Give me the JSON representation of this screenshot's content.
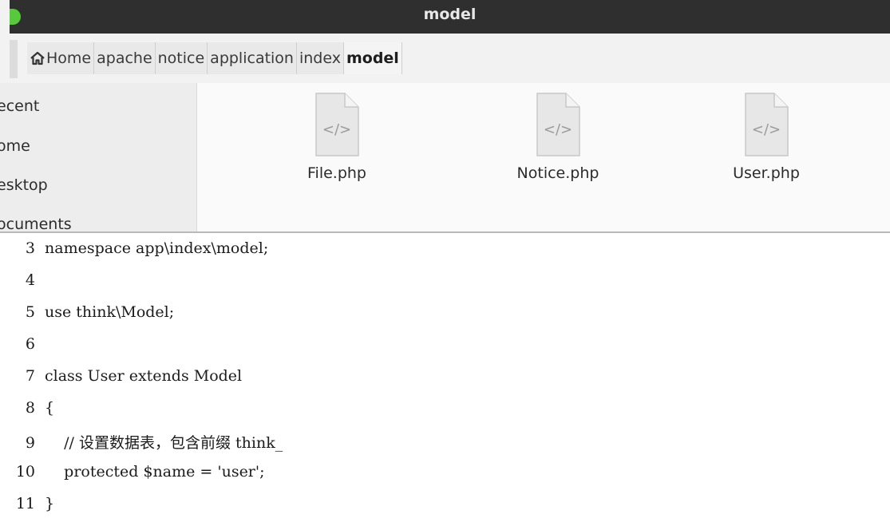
{
  "window": {
    "title": "model"
  },
  "breadcrumbs": [
    {
      "label": "Home",
      "icon": "home-icon"
    },
    {
      "label": "apache"
    },
    {
      "label": "notice"
    },
    {
      "label": "application"
    },
    {
      "label": "index"
    },
    {
      "label": "model",
      "active": true
    }
  ],
  "sidebar": {
    "items": [
      {
        "label": "ecent"
      },
      {
        "label": "ome"
      },
      {
        "label": "esktop"
      },
      {
        "label": "ocuments"
      }
    ]
  },
  "files": [
    {
      "name": "File.php",
      "icon": "php-file-icon",
      "glyph": "</>"
    },
    {
      "name": "Notice.php",
      "icon": "php-file-icon",
      "glyph": "</>"
    },
    {
      "name": "User.php",
      "icon": "php-file-icon",
      "glyph": "</>"
    }
  ],
  "code": {
    "lines": [
      {
        "num": "3",
        "text": "namespace app\\index\\model;"
      },
      {
        "num": "4",
        "text": ""
      },
      {
        "num": "5",
        "text": "use think\\Model;"
      },
      {
        "num": "6",
        "text": ""
      },
      {
        "num": "7",
        "text": "class User extends Model"
      },
      {
        "num": "8",
        "text": "{"
      },
      {
        "num": "9",
        "text": "    // 设置数据表，包含前缀 think_"
      },
      {
        "num": "10",
        "text": "    protected $name = 'user';"
      },
      {
        "num": "11",
        "text": "}"
      }
    ]
  }
}
